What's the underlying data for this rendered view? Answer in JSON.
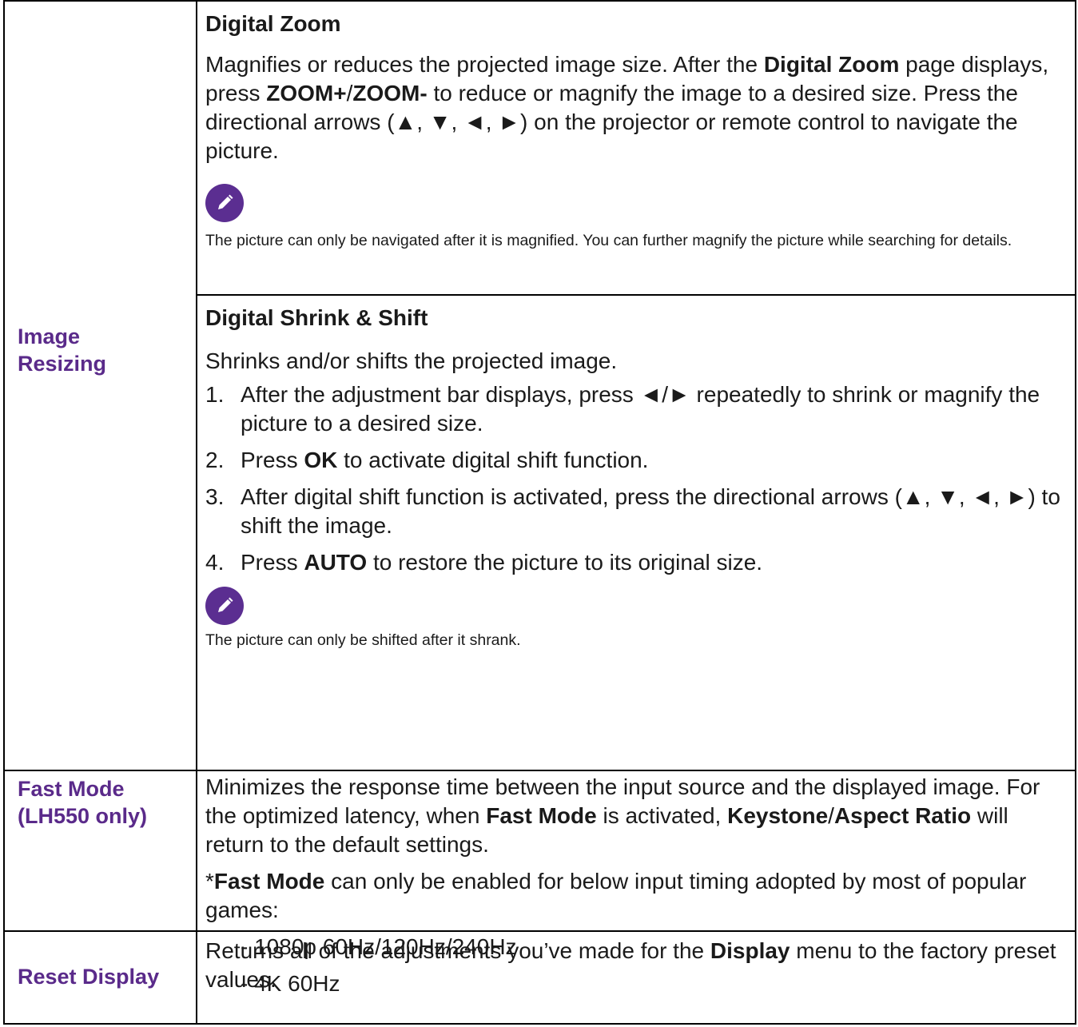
{
  "rows": {
    "image_resizing": {
      "label_line1": "Image",
      "label_line2": "Resizing",
      "digital_zoom": {
        "heading": "Digital Zoom",
        "para": [
          {
            "t": "Magnifies or reduces the projected image size. After the ",
            "b": false
          },
          {
            "t": "Digital Zoom",
            "b": true
          },
          {
            "t": " page displays, press ",
            "b": false
          },
          {
            "t": "ZOOM+",
            "b": true
          },
          {
            "t": "/",
            "b": false
          },
          {
            "t": "ZOOM-",
            "b": true
          },
          {
            "t": " to reduce or magnify the image to a desired size. Press the directional arrows (▲, ▼, ◄, ►) on the projector or remote control to navigate the picture.",
            "b": false
          }
        ],
        "note_icon": "pencil-icon",
        "note": "The picture can only be navigated after it is magnified. You can further magnify the picture while searching for details."
      },
      "digital_shrink": {
        "heading": "Digital Shrink & Shift",
        "intro": "Shrinks and/or shifts the projected image.",
        "steps": [
          {
            "num": "1.",
            "parts": [
              {
                "t": "After the adjustment bar displays, press ◄/► repeatedly to shrink or magnify the picture to a desired size.",
                "b": false
              }
            ]
          },
          {
            "num": "2.",
            "parts": [
              {
                "t": "Press ",
                "b": false
              },
              {
                "t": "OK",
                "b": true
              },
              {
                "t": " to activate digital shift function.",
                "b": false
              }
            ]
          },
          {
            "num": "3.",
            "parts": [
              {
                "t": "After digital shift function is activated, press the directional arrows (▲, ▼, ◄, ►) to shift the image.",
                "b": false
              }
            ]
          },
          {
            "num": "4.",
            "parts": [
              {
                "t": "Press ",
                "b": false
              },
              {
                "t": "AUTO",
                "b": true
              },
              {
                "t": " to restore the picture to its original size.",
                "b": false
              }
            ]
          }
        ],
        "note_icon": "pencil-icon",
        "note": "The picture can only be shifted after it shrank."
      }
    },
    "fast_mode": {
      "label_line1": "Fast Mode",
      "label_line2": "(LH550 only)",
      "para1": [
        {
          "t": "Minimizes the response time between the input source and the displayed image. For the optimized latency, when ",
          "b": false
        },
        {
          "t": "Fast Mode",
          "b": true
        },
        {
          "t": " is activated, ",
          "b": false
        },
        {
          "t": "Keystone",
          "b": true
        },
        {
          "t": "/",
          "b": false
        },
        {
          "t": "Aspect Ratio",
          "b": true
        },
        {
          "t": " will return to the default settings.",
          "b": false
        }
      ],
      "para2": [
        {
          "t": "*",
          "b": false
        },
        {
          "t": "Fast Mode",
          "b": true
        },
        {
          "t": " can only be enabled for below input timing adopted by most of popular games:",
          "b": false
        }
      ],
      "timing1": "- 1080p 60Hz/120Hz/240Hz",
      "timing2": "- 4K 60Hz"
    },
    "reset_display": {
      "label": "Reset Display",
      "para": [
        {
          "t": "Returns all of the adjustments you’ve made for the ",
          "b": false
        },
        {
          "t": "Display",
          "b": true
        },
        {
          "t": " menu to the factory preset values.",
          "b": false
        }
      ]
    }
  },
  "colors": {
    "label": "#5a2a8a",
    "icon_bg": "#5b2e91",
    "border": "#000000",
    "text": "#1a1a1a"
  }
}
